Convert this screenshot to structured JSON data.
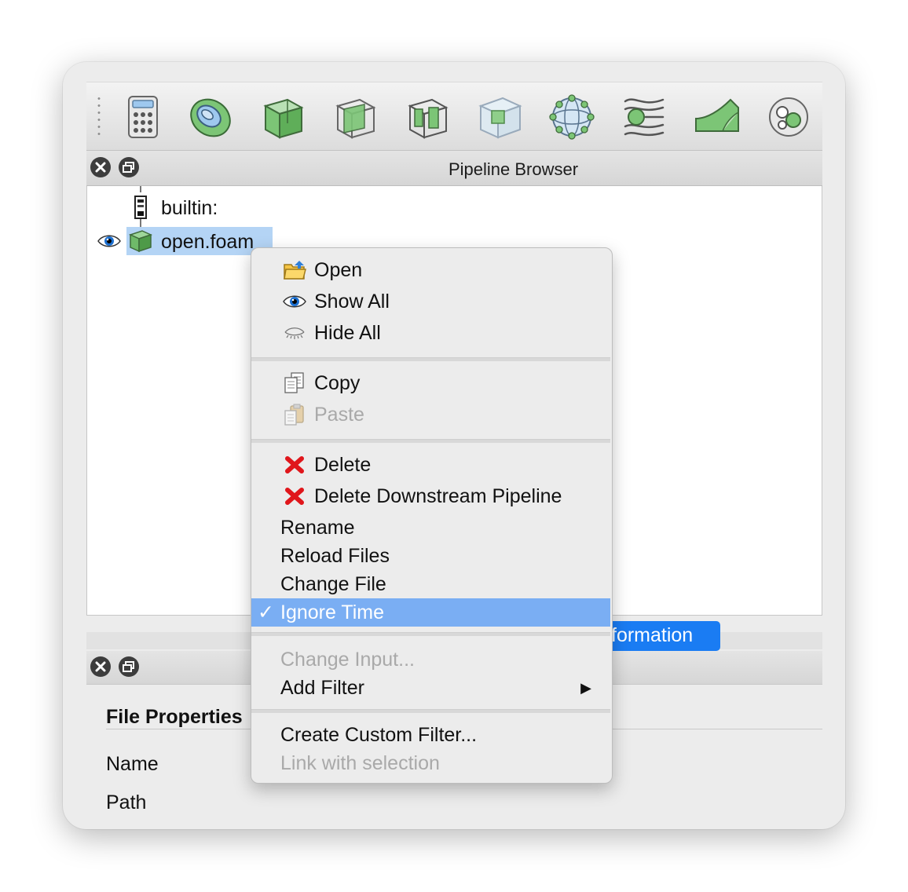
{
  "pipeline_browser": {
    "title": "Pipeline Browser",
    "items": [
      {
        "label": "builtin:",
        "icon": "server-icon"
      },
      {
        "label": "open.foam",
        "icon": "green-cube-icon",
        "visible": true,
        "selected": true
      }
    ]
  },
  "toolbar": {
    "icons": [
      "calculator-icon",
      "contour-icon",
      "clip-icon",
      "slice-icon",
      "threshold-icon",
      "extract-subset-icon",
      "glyph-icon",
      "stream-tracer-icon",
      "warp-icon",
      "group-icon"
    ]
  },
  "properties_panel": {
    "tab_label": "Information",
    "tab_visible_text": "formation",
    "section_title": "File Properties",
    "rows": [
      "Name",
      "Path"
    ]
  },
  "context_menu": {
    "groups": [
      [
        {
          "label": "Open",
          "icon": "folder-open-icon",
          "enabled": true
        },
        {
          "label": "Show All",
          "icon": "eye-icon",
          "enabled": true
        },
        {
          "label": "Hide All",
          "icon": "eye-closed-icon",
          "enabled": true
        }
      ],
      [
        {
          "label": "Copy",
          "icon": "copy-icon",
          "enabled": true
        },
        {
          "label": "Paste",
          "icon": "paste-icon",
          "enabled": false
        }
      ],
      [
        {
          "label": "Delete",
          "icon": "delete-icon",
          "enabled": true
        },
        {
          "label": "Delete Downstream Pipeline",
          "icon": "delete-icon",
          "enabled": true
        },
        {
          "label": "Rename",
          "enabled": true
        },
        {
          "label": "Reload Files",
          "enabled": true
        },
        {
          "label": "Change File",
          "enabled": true
        },
        {
          "label": "Ignore Time",
          "enabled": true,
          "checked": true,
          "highlighted": true
        }
      ],
      [
        {
          "label": "Change Input...",
          "enabled": false
        },
        {
          "label": "Add Filter",
          "enabled": true,
          "submenu": true
        }
      ],
      [
        {
          "label": "Create Custom Filter...",
          "enabled": true
        },
        {
          "label": "Link with selection",
          "enabled": false
        }
      ]
    ],
    "check_glyph": "✓",
    "submenu_glyph": "▶"
  },
  "colors": {
    "selection": "#b4d4f5",
    "menu_highlight": "#7aaef3",
    "tab_active": "#1a7cf3",
    "filter_green": "#7cc576",
    "delete_red": "#e0161b"
  }
}
